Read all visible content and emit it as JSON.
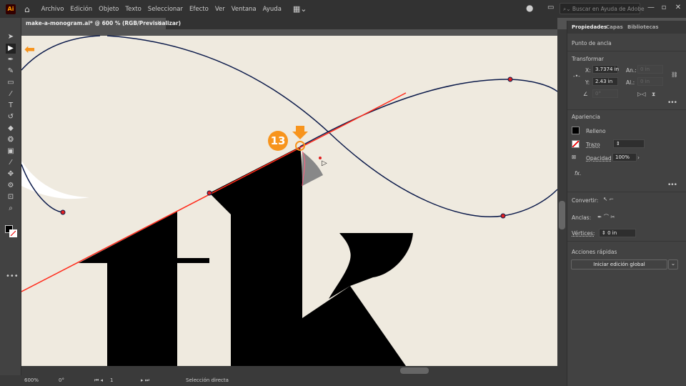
{
  "app": {
    "logo": "Ai",
    "menu": [
      "Archivo",
      "Edición",
      "Objeto",
      "Texto",
      "Seleccionar",
      "Efecto",
      "Ver",
      "Ventana",
      "Ayuda"
    ],
    "search_placeholder": "Buscar en Ayuda de Adobe"
  },
  "document": {
    "tab_title": "make-a-monogram.ai* @ 600 % (RGB/Previsualizar)",
    "close": "×"
  },
  "annotation": {
    "step_number": "13",
    "accent": "#f7941d"
  },
  "panel": {
    "tabs": [
      "Propiedades",
      "Capas",
      "Bibliotecas"
    ],
    "selection_type": "Punto de ancla",
    "transform": {
      "title": "Transformar",
      "x_label": "X:",
      "x": "3.7374 in",
      "y_label": "Y:",
      "y": "2.43 in",
      "w_label": "An.:",
      "w": "0 in",
      "h_label": "Al.:",
      "h": "0 in",
      "angle": "0°"
    },
    "appearance": {
      "title": "Apariencia",
      "fill": "Relleno",
      "stroke": "Trazo",
      "opacity_label": "Opacidad",
      "opacity": "100%",
      "fx": "fx."
    },
    "convert_label": "Convertir:",
    "anchors_label": "Anclas:",
    "corners_label": "Vértices:",
    "corners": "0 in",
    "quick_actions": {
      "title": "Acciones rápidas",
      "button": "Iniciar edición global"
    }
  },
  "status": {
    "zoom": "600%",
    "rotation": "0°",
    "artboard": "1",
    "tool": "Selección directa"
  },
  "colors": {
    "artboard": "#efeadf",
    "path": "#0b1a4a",
    "guide": "#ff2a1a"
  }
}
